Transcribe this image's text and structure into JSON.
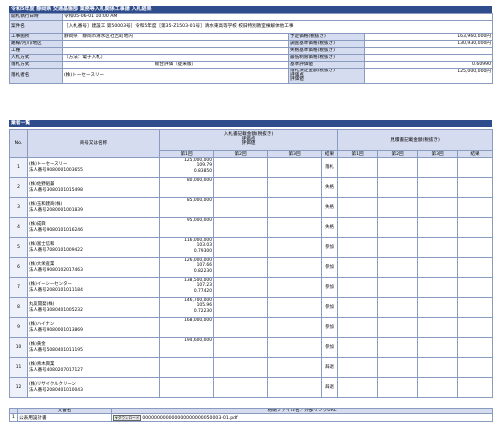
{
  "page_title": "令和5年度 静岡県 交通基盤部 業務等入札関係工事請 入札結果",
  "info": {
    "open_date": {
      "label": "開札執行日時",
      "value": "令和05-06-01 10:00 AM"
    },
    "case_name": {
      "label": "案件名",
      "value": "［入札番号］建設工 第50003号］令和5年度［第35-Z1503-01号］清水東高等学校 校旧特別教室棟解体他工事"
    },
    "place": {
      "label": "工事箇所",
      "value": "静岡県　静岡市清水区社吉町地内"
    },
    "area": {
      "label": "路線/河川/地区",
      "value": ""
    },
    "type": {
      "label": "工種",
      "value": ""
    },
    "method": {
      "label": "入札方式",
      "value": "（方法：電子入札）"
    },
    "judge": {
      "label": "落札方式",
      "value": "総合評価（従来版）"
    },
    "winner": {
      "label": "落札者名",
      "value": "(株)トーセースリー"
    },
    "right": [
      {
        "label": "予定価格(税抜き)",
        "value": "163,960,000円"
      },
      {
        "label": "調査基準価格(税抜き)",
        "value": "130,930,000円"
      },
      {
        "label": "失格基準価格(税抜き)",
        "value": ""
      },
      {
        "label": "最低制限価格(税抜き)",
        "value": ""
      },
      {
        "label": "基準評価値",
        "value": "0.60990"
      }
    ],
    "award": {
      "label1": "落札決定金額(税抜き)",
      "label2": "評価点",
      "label3": "評価値",
      "value": "125,000,000円"
    }
  },
  "bid_section": {
    "title": "業者一覧",
    "col_no": "No.",
    "col_name": "商号又は名称",
    "group1": "入札書記載金額(税抜き)\n評価点\n評価値",
    "group2": "見積書記載金額(税抜き)",
    "round1": "第1回",
    "round2": "第2回",
    "round3": "第3回",
    "result": "結果"
  },
  "bidders": [
    {
      "no": "1",
      "name": "(株)トーセースリー",
      "corp": "法人番号9080001003655",
      "v1": "125,000,000",
      "v2": "109.79",
      "v3": "0.83850",
      "result": "落札"
    },
    {
      "no": "2",
      "name": "(株)佐野組兼",
      "corp": "法人番号3080101015498",
      "v1": "80,000,000",
      "v2": "",
      "v3": "",
      "result": "失格"
    },
    {
      "no": "3",
      "name": "(株)玉和建商(株)",
      "corp": "法人番号2080001001839",
      "v1": "85,000,000",
      "v2": "",
      "v3": "",
      "result": "失格"
    },
    {
      "no": "4",
      "name": "(株)成興",
      "corp": "法人番号9080101016246",
      "v1": "95,000,000",
      "v2": "",
      "v3": "",
      "result": "失格"
    },
    {
      "no": "5",
      "name": "(株)富士信和",
      "corp": "法人番号7080101009422",
      "v1": "116,000,000",
      "v2": "103.03",
      "v3": "0.79300",
      "result": "参加"
    },
    {
      "no": "6",
      "name": "(株)大栄産業",
      "corp": "法人番号9080102017463",
      "v1": "126,000,000",
      "v2": "107.66",
      "v3": "0.82230",
      "result": "参加"
    },
    {
      "no": "7",
      "name": "(株)イーシーセンター",
      "corp": "法人番号2080101011184",
      "v1": "138,500,000",
      "v2": "107.23",
      "v3": "0.77420",
      "result": "参加"
    },
    {
      "no": "8",
      "name": "丸友開発(株)",
      "corp": "法人番号3080401005232",
      "v1": "146,700,000",
      "v2": "105.96",
      "v3": "0.72230",
      "result": "参加"
    },
    {
      "no": "9",
      "name": "(株)ハイナン",
      "corp": "法人番号9080001013869",
      "v1": "168,000,000",
      "v2": "",
      "v3": "",
      "result": "参加"
    },
    {
      "no": "10",
      "name": "(株)黄金",
      "corp": "法人番号5080401011195",
      "v1": "194,600,000",
      "v2": "",
      "v3": "",
      "result": "参加"
    },
    {
      "no": "11",
      "name": "(株)青木興業",
      "corp": "法人番号4080207017127",
      "v1": "",
      "v2": "",
      "v3": "",
      "result": "辞退"
    },
    {
      "no": "12",
      "name": "(株)リサイクルクリーン",
      "corp": "法人番号2080401010043",
      "v1": "",
      "v2": "",
      "v3": "",
      "result": "辞退"
    }
  ],
  "docs_section": {
    "title": "説明文書等",
    "col_name": "文書名",
    "col_file": "格納ファイル名／外部リンクURL",
    "rows": [
      {
        "no": "1",
        "name": "公表用設計書",
        "button": "ダウンロード",
        "file": "000000000000000000000050003-01.pdf"
      }
    ]
  }
}
